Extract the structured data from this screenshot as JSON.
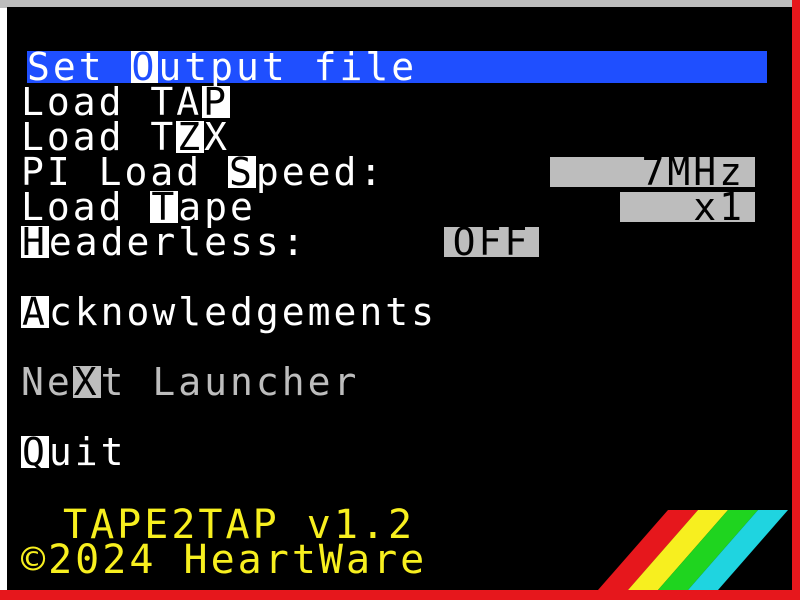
{
  "menu": {
    "set_output": {
      "pre": "Set ",
      "key": "O",
      "post": "utput file"
    },
    "load_tap": {
      "pre": "Load TA",
      "key": "P",
      "post": ""
    },
    "load_tzx": {
      "pre": "Load T",
      "key": "Z",
      "post": "X"
    },
    "pi_load_speed": {
      "pre": "PI Load ",
      "key": "S",
      "post": "peed:",
      "value": "7MHz"
    },
    "load_tape": {
      "pre": "Load ",
      "key": "T",
      "post": "ape",
      "value": "x1"
    },
    "headerless": {
      "pre": "",
      "key": "H",
      "post": "eaderless:",
      "value": "OFF"
    },
    "acknowledgements": {
      "pre": "",
      "key": "A",
      "post": "cknowledgements"
    },
    "next_launcher": {
      "pre": "Ne",
      "key": "X",
      "post": "t Launcher"
    },
    "quit": {
      "pre": "",
      "key": "Q",
      "post": "uit"
    }
  },
  "footer": {
    "app_version": "TAPE2TAP v1.2",
    "copyright": "©2024 HeartWare"
  },
  "colors": {
    "background": "#000000",
    "selection": "#1f4fff",
    "text": "#ffffff",
    "dim_text": "#bdbdbd",
    "value_box": "#bdbdbd",
    "footer_text": "#f7ef1f",
    "border_red": "#e6171c",
    "stripe_colors": [
      "#e6171c",
      "#f7ef1f",
      "#1fd41f",
      "#1fd4e0"
    ]
  }
}
